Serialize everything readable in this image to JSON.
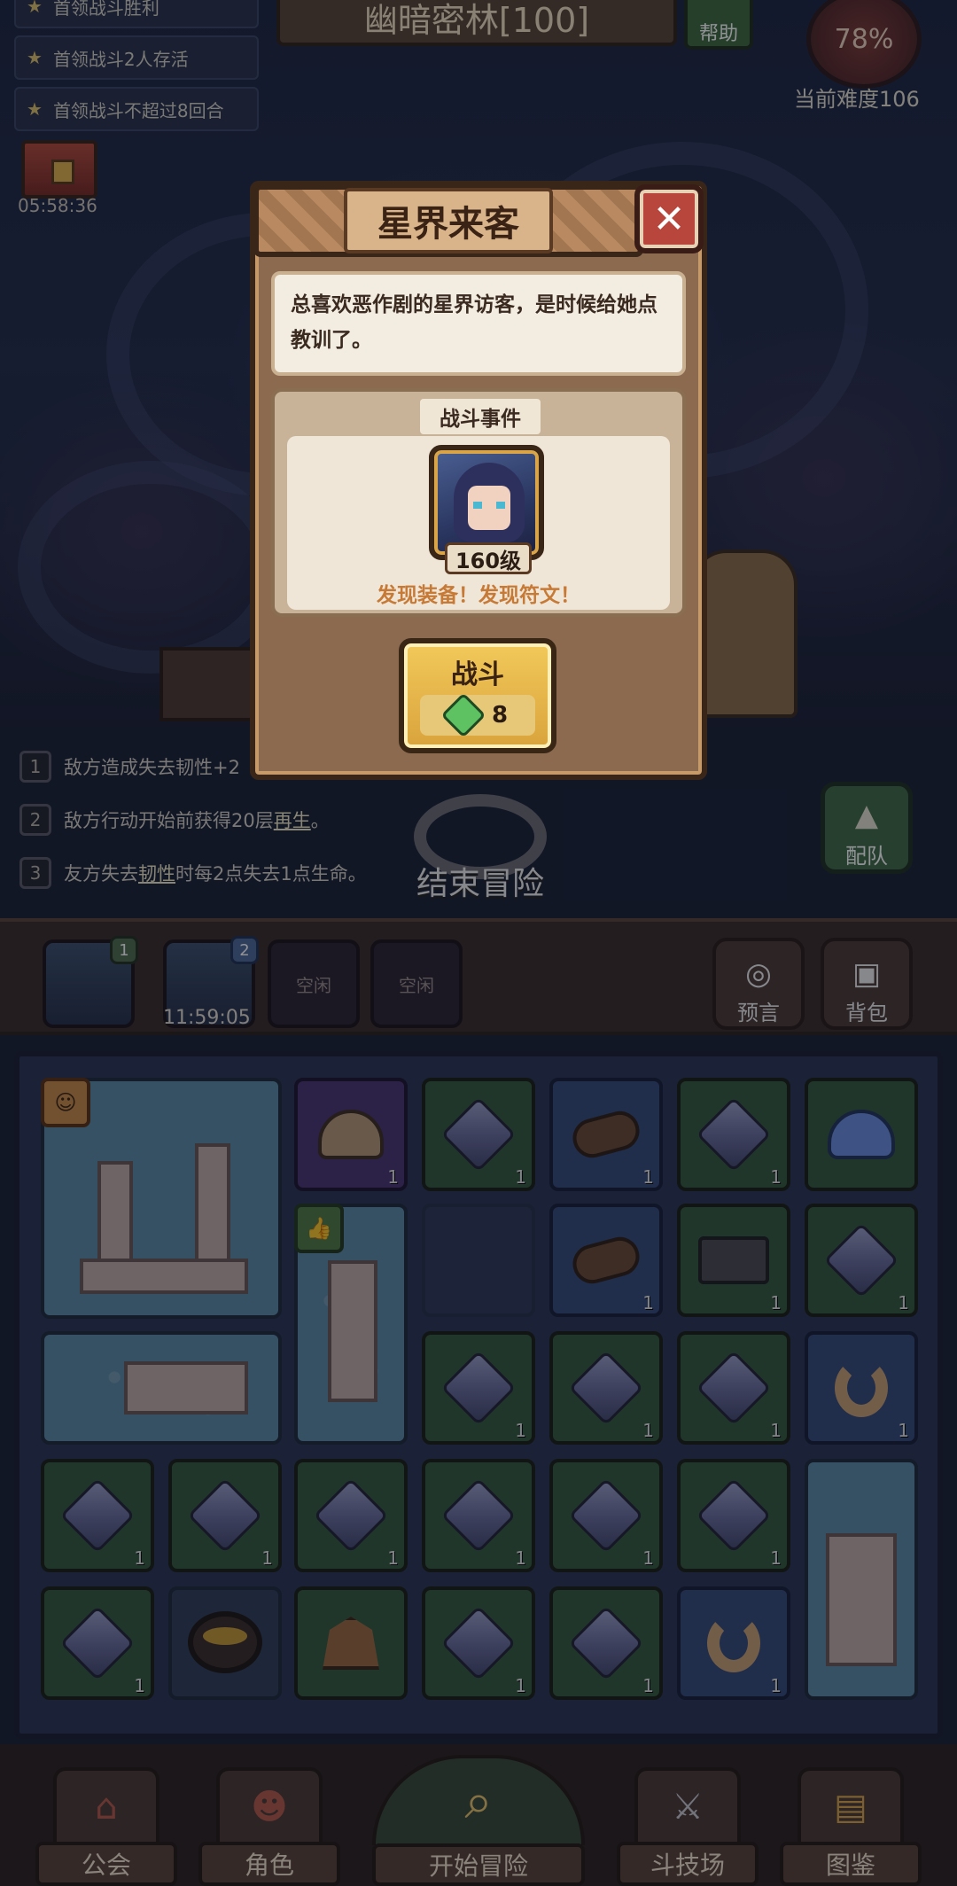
{
  "tasks": [
    {
      "label": "首领战斗胜利"
    },
    {
      "label": "首领战斗2人存活"
    },
    {
      "label": "首领战斗不超过8回合"
    }
  ],
  "chest": {
    "timer": "05:58:36"
  },
  "stage": {
    "title": "幽暗密林[100]"
  },
  "help": {
    "label": "帮助"
  },
  "difficulty": {
    "percent": "78%",
    "label": "当前难度106"
  },
  "buffs": [
    {
      "num": "1",
      "text": "敌方造成失去韧性+2"
    },
    {
      "num": "2",
      "pre": "敌方行动开始前获得20层",
      "kw": "再生",
      "post": "。"
    },
    {
      "num": "3",
      "pre": "友方失去",
      "kw": "韧性",
      "post": "时每2点失去1点生命。"
    }
  ],
  "end_adventure": {
    "label": "结束冒险"
  },
  "formation": {
    "label": "配队"
  },
  "slots": [
    {
      "badge": "1"
    },
    {
      "badge": "2",
      "timer": "11:59:05"
    },
    {
      "label": "空闲"
    },
    {
      "label": "空闲"
    }
  ],
  "side_buttons": {
    "prophecy": "预言",
    "backpack": "背包"
  },
  "grid_counts": {
    "item": "1"
  },
  "bottom_nav": [
    {
      "label": "公会"
    },
    {
      "label": "角色"
    },
    {
      "label": "开始冒险"
    },
    {
      "label": "斗技场"
    },
    {
      "label": "图鉴"
    }
  ],
  "modal": {
    "title": "星界来客",
    "description": "总喜欢恶作剧的星界访客，是时候给她点教训了。",
    "event_tag": "战斗事件",
    "boss_level": "160级",
    "rewards": "发现装备！发现符文！",
    "fight_label": "战斗",
    "fight_cost": "8"
  },
  "colors": {
    "accent_gold": "#f2c95a",
    "close_red": "#b8463c",
    "reward_orange": "#c67a36"
  }
}
